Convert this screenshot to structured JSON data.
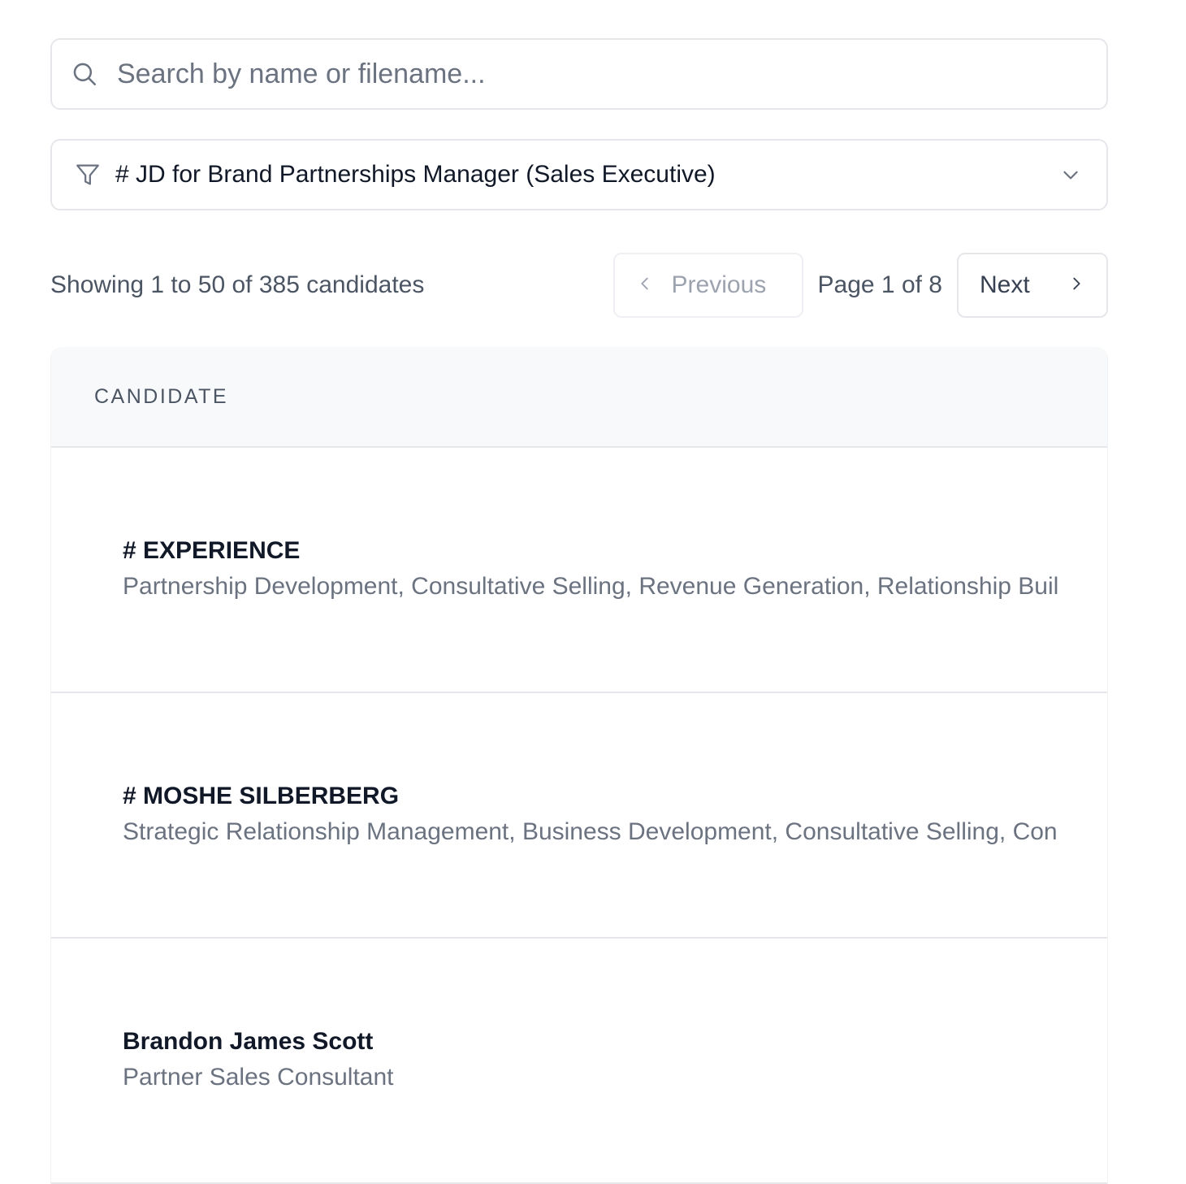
{
  "search": {
    "placeholder": "Search by name or filename...",
    "value": ""
  },
  "filter": {
    "selected": "# JD for Brand Partnerships Manager (Sales Executive)"
  },
  "pagination": {
    "showing_text": "Showing 1 to 50 of 385 candidates",
    "previous_label": "Previous",
    "page_text": "Page 1 of 8",
    "next_label": "Next"
  },
  "table": {
    "column_header": "CANDIDATE",
    "rows": [
      {
        "name": "# EXPERIENCE",
        "subtitle": "Partnership Development, Consultative Selling, Revenue Generation, Relationship Buil"
      },
      {
        "name": "# MOSHE SILBERBERG",
        "subtitle": "Strategic Relationship Management, Business Development, Consultative Selling, Con"
      },
      {
        "name": "Brandon James Scott",
        "subtitle": "Partner Sales Consultant"
      }
    ]
  },
  "icons": {
    "search": "search-icon",
    "filter": "filter-icon",
    "dropdown": "chevron-down-icon",
    "prev": "chevron-left-icon",
    "next": "chevron-right-icon"
  },
  "colors": {
    "border": "#e5e7eb",
    "header_bg": "#f8f9fb",
    "text_primary": "#111827",
    "text_secondary": "#6b7280",
    "disabled": "#9ca3af"
  }
}
